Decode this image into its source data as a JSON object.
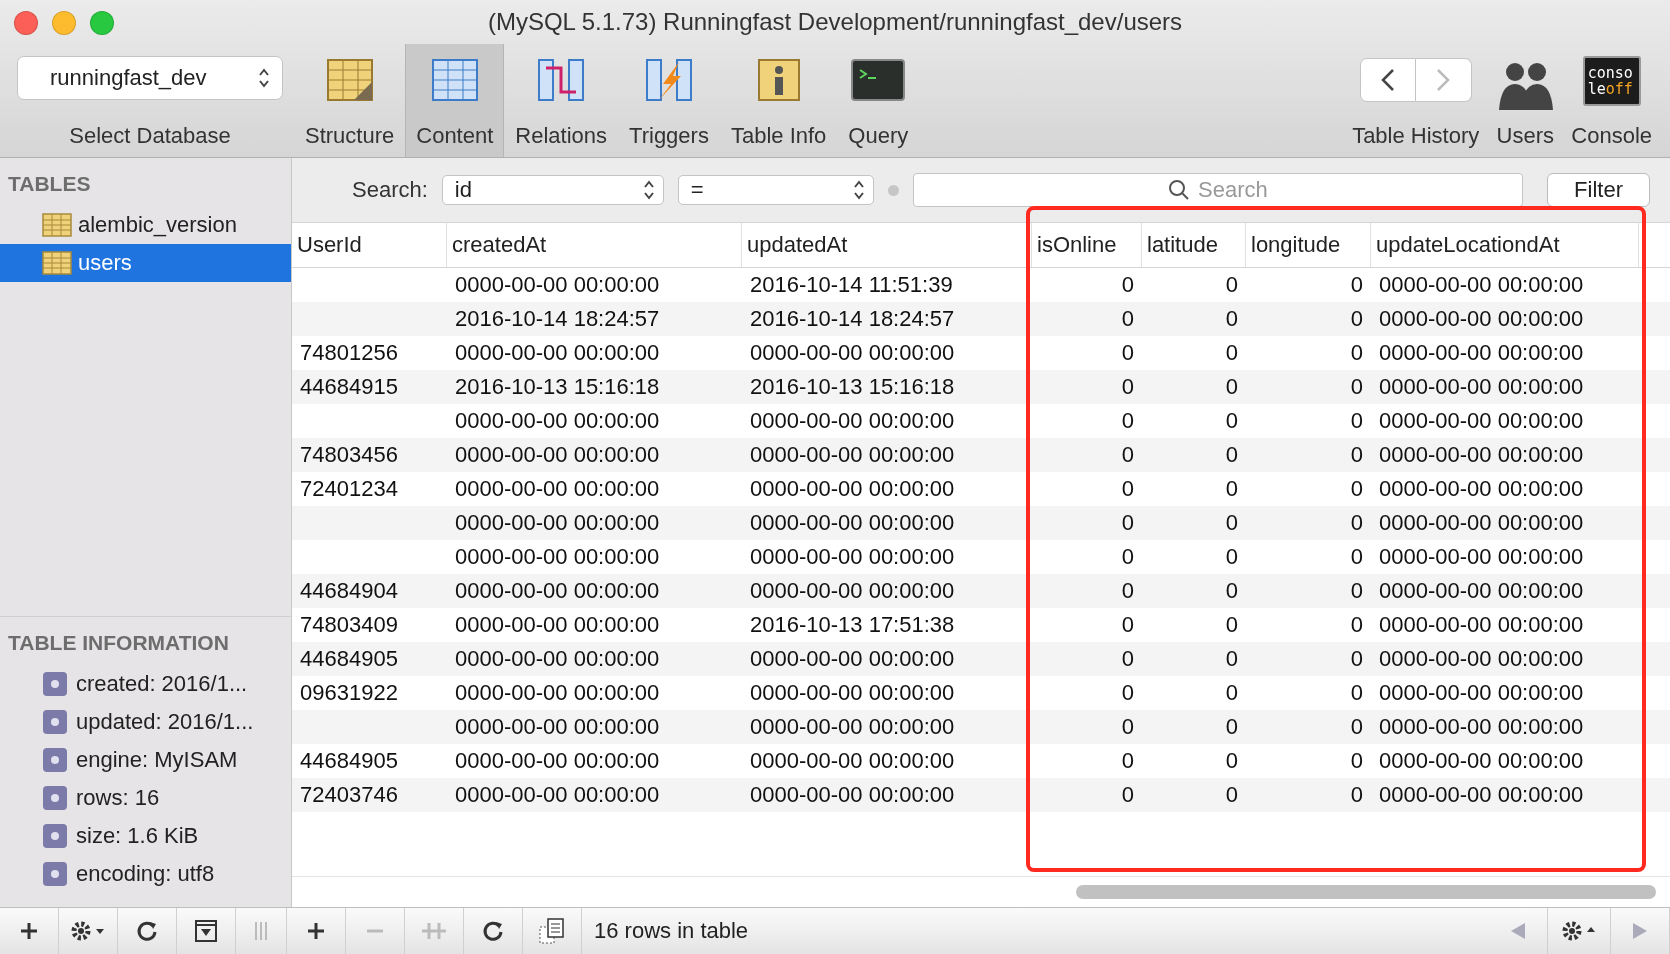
{
  "window": {
    "title": "(MySQL 5.1.73) Runningfast Development/runningfast_dev/users"
  },
  "toolbar": {
    "database": {
      "value": "runningfast_dev",
      "label": "Select Database"
    },
    "tabs": [
      {
        "label": "Structure",
        "kind": "structure",
        "selected": false
      },
      {
        "label": "Content",
        "kind": "content",
        "selected": true
      },
      {
        "label": "Relations",
        "kind": "relations",
        "selected": false
      },
      {
        "label": "Triggers",
        "kind": "triggers",
        "selected": false
      },
      {
        "label": "Table Info",
        "kind": "info",
        "selected": false
      },
      {
        "label": "Query",
        "kind": "query",
        "selected": false
      }
    ],
    "history_label": "Table History",
    "right_items": [
      {
        "label": "Users",
        "kind": "users"
      },
      {
        "label": "Console",
        "kind": "console",
        "icon_text": [
          "conso",
          "le",
          "off"
        ]
      }
    ]
  },
  "sidebar": {
    "tables_heading": "TABLES",
    "tables": [
      {
        "name": "alembic_version",
        "selected": false
      },
      {
        "name": "users",
        "selected": true
      }
    ],
    "info_heading": "TABLE INFORMATION",
    "info": [
      "created: 2016/1...",
      "updated: 2016/1...",
      "engine: MyISAM",
      "rows: 16",
      "size: 1.6 KiB",
      "encoding: utf8"
    ]
  },
  "filter": {
    "label": "Search:",
    "field": "id",
    "operator": "=",
    "placeholder": "Search",
    "button": "Filter"
  },
  "table": {
    "columns": [
      {
        "label": "UserId",
        "kind": "text"
      },
      {
        "label": "createdAt",
        "kind": "text"
      },
      {
        "label": "updatedAt",
        "kind": "text"
      },
      {
        "label": "isOnline",
        "kind": "number"
      },
      {
        "label": "latitude",
        "kind": "number"
      },
      {
        "label": "longitude",
        "kind": "number"
      },
      {
        "label": "updateLocationdAt",
        "kind": "text"
      }
    ],
    "rows": [
      [
        "",
        "0000-00-00 00:00:00",
        "2016-10-14 11:51:39",
        "0",
        "0",
        "0",
        "0000-00-00 00:00:00"
      ],
      [
        "",
        "2016-10-14 18:24:57",
        "2016-10-14 18:24:57",
        "0",
        "0",
        "0",
        "0000-00-00 00:00:00"
      ],
      [
        "74801256",
        "0000-00-00 00:00:00",
        "0000-00-00 00:00:00",
        "0",
        "0",
        "0",
        "0000-00-00 00:00:00"
      ],
      [
        "44684915",
        "2016-10-13 15:16:18",
        "2016-10-13 15:16:18",
        "0",
        "0",
        "0",
        "0000-00-00 00:00:00"
      ],
      [
        "",
        "0000-00-00 00:00:00",
        "0000-00-00 00:00:00",
        "0",
        "0",
        "0",
        "0000-00-00 00:00:00"
      ],
      [
        "74803456",
        "0000-00-00 00:00:00",
        "0000-00-00 00:00:00",
        "0",
        "0",
        "0",
        "0000-00-00 00:00:00"
      ],
      [
        "72401234",
        "0000-00-00 00:00:00",
        "0000-00-00 00:00:00",
        "0",
        "0",
        "0",
        "0000-00-00 00:00:00"
      ],
      [
        "",
        "0000-00-00 00:00:00",
        "0000-00-00 00:00:00",
        "0",
        "0",
        "0",
        "0000-00-00 00:00:00"
      ],
      [
        "",
        "0000-00-00 00:00:00",
        "0000-00-00 00:00:00",
        "0",
        "0",
        "0",
        "0000-00-00 00:00:00"
      ],
      [
        "44684904",
        "0000-00-00 00:00:00",
        "0000-00-00 00:00:00",
        "0",
        "0",
        "0",
        "0000-00-00 00:00:00"
      ],
      [
        "74803409",
        "0000-00-00 00:00:00",
        "2016-10-13 17:51:38",
        "0",
        "0",
        "0",
        "0000-00-00 00:00:00"
      ],
      [
        "44684905",
        "0000-00-00 00:00:00",
        "0000-00-00 00:00:00",
        "0",
        "0",
        "0",
        "0000-00-00 00:00:00"
      ],
      [
        "09631922",
        "0000-00-00 00:00:00",
        "0000-00-00 00:00:00",
        "0",
        "0",
        "0",
        "0000-00-00 00:00:00"
      ],
      [
        "",
        "0000-00-00 00:00:00",
        "0000-00-00 00:00:00",
        "0",
        "0",
        "0",
        "0000-00-00 00:00:00"
      ],
      [
        "44684905",
        "0000-00-00 00:00:00",
        "0000-00-00 00:00:00",
        "0",
        "0",
        "0",
        "0000-00-00 00:00:00"
      ],
      [
        "72403746",
        "0000-00-00 00:00:00",
        "0000-00-00 00:00:00",
        "0",
        "0",
        "0",
        "0000-00-00 00:00:00"
      ]
    ]
  },
  "highlight_frame": true,
  "status": "16 rows in table"
}
